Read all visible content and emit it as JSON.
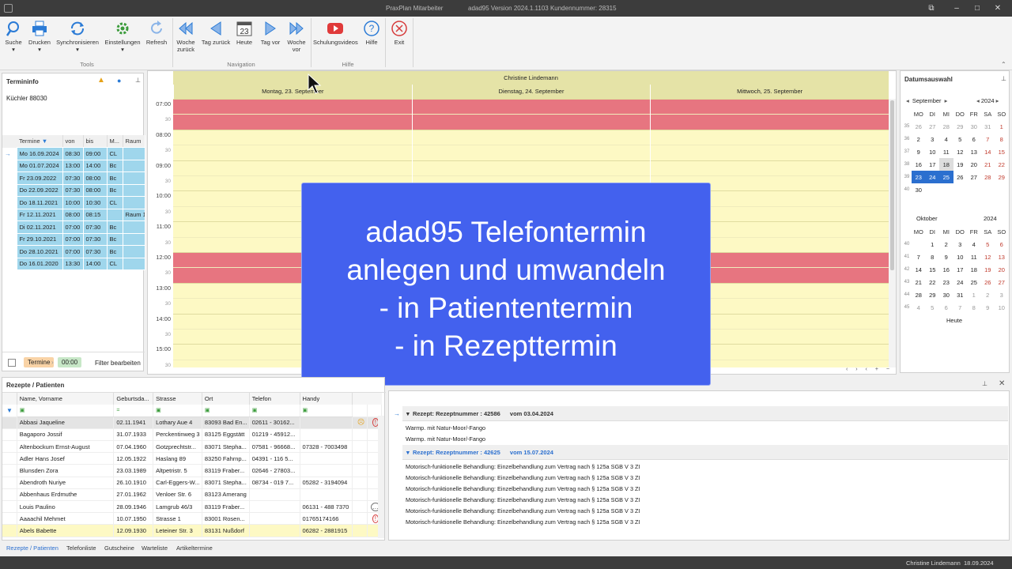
{
  "titlebar": {
    "app": "PraxPlan Mitarbeiter",
    "version": "adad95 Version 2024.1.1103  Kundennummer: 28315"
  },
  "ribbon": {
    "buttons": [
      {
        "label": "Suche",
        "sub": "▾"
      },
      {
        "label": "Drucken",
        "sub": "▾"
      },
      {
        "label": "Synchronisieren",
        "sub": "▾"
      },
      {
        "label": "Einstellungen",
        "sub": "▾"
      },
      {
        "label": "Refresh",
        "sub": ""
      },
      {
        "label": "Woche",
        "sub": "zurück"
      },
      {
        "label": "Tag zurück",
        "sub": ""
      },
      {
        "label": "Heute",
        "sub": ""
      },
      {
        "label": "Tag vor",
        "sub": ""
      },
      {
        "label": "Woche",
        "sub": "vor"
      },
      {
        "label": "Schulungsvideos",
        "sub": ""
      },
      {
        "label": "Hilfe",
        "sub": ""
      },
      {
        "label": "Exit",
        "sub": ""
      }
    ],
    "heute_day": "23",
    "groups": [
      "Tools",
      "Navigation",
      "Hilfe"
    ]
  },
  "termininfo": {
    "title": "Termininfo",
    "patient": "Küchler 88030",
    "columns": [
      "Termine",
      "von",
      "bis",
      "M...",
      "Raum"
    ],
    "rows": [
      [
        "Mo 16.09.2024",
        "08:30",
        "09:00",
        "CL",
        ""
      ],
      [
        "Mo 01.07.2024",
        "13:00",
        "14:00",
        "Bc",
        ""
      ],
      [
        "Fr 23.09.2022",
        "07:30",
        "08:00",
        "Bc",
        ""
      ],
      [
        "Do 22.09.2022",
        "07:30",
        "08:00",
        "Bc",
        ""
      ],
      [
        "Do 18.11.2021",
        "10:00",
        "10:30",
        "CL",
        ""
      ],
      [
        "Fr 12.11.2021",
        "08:00",
        "08:15",
        "",
        "Raum 1"
      ],
      [
        "Di 02.11.2021",
        "07:00",
        "07:30",
        "Bc",
        ""
      ],
      [
        "Fr 29.10.2021",
        "07:00",
        "07:30",
        "Bc",
        ""
      ],
      [
        "Do 28.10.2021",
        "07:00",
        "07:30",
        "Bc",
        ""
      ],
      [
        "Do 16.01.2020",
        "13:30",
        "14:00",
        "CL",
        ""
      ]
    ],
    "footer": {
      "chip1": "Termine",
      "chip2": "00:00",
      "filter": "Filter bearbeiten"
    }
  },
  "calendar": {
    "therapist": "Christine Lindemann",
    "days": [
      "Montag, 23. September",
      "Dienstag, 24. September",
      "Mittwoch, 25. September"
    ],
    "hours": [
      "07:00",
      "08:00",
      "09:00",
      "10:00",
      "11:00",
      "12:00",
      "13:00",
      "14:00",
      "15:00"
    ],
    "half": "30"
  },
  "overlay": {
    "lines": [
      "adad95 Telefontermin",
      "anlegen und umwandeln",
      "- in Patiententermin",
      "- in Rezepttermin"
    ]
  },
  "datumsauswahl": {
    "title": "Datumsauswahl",
    "month1": "September",
    "year1": "2024",
    "month2": "Oktober",
    "year2": "2024",
    "weekdays": [
      "MO",
      "DI",
      "MI",
      "DO",
      "FR",
      "SA",
      "SO"
    ],
    "sep_weeks": [
      [
        "35",
        "26",
        "27",
        "28",
        "29",
        "30",
        "31",
        "1"
      ],
      [
        "36",
        "2",
        "3",
        "4",
        "5",
        "6",
        "7",
        "8"
      ],
      [
        "37",
        "9",
        "10",
        "11",
        "12",
        "13",
        "14",
        "15"
      ],
      [
        "38",
        "16",
        "17",
        "18",
        "19",
        "20",
        "21",
        "22"
      ],
      [
        "39",
        "23",
        "24",
        "25",
        "26",
        "27",
        "28",
        "29"
      ],
      [
        "40",
        "30",
        "",
        "",
        "",
        "",
        "",
        ""
      ]
    ],
    "oct_weeks": [
      [
        "40",
        "",
        "1",
        "2",
        "3",
        "4",
        "5",
        "6"
      ],
      [
        "41",
        "7",
        "8",
        "9",
        "10",
        "11",
        "12",
        "13"
      ],
      [
        "42",
        "14",
        "15",
        "16",
        "17",
        "18",
        "19",
        "20"
      ],
      [
        "43",
        "21",
        "22",
        "23",
        "24",
        "25",
        "26",
        "27"
      ],
      [
        "44",
        "28",
        "29",
        "30",
        "31",
        "1",
        "2",
        "3"
      ],
      [
        "45",
        "4",
        "5",
        "6",
        "7",
        "8",
        "9",
        "10"
      ]
    ],
    "heute": "Heute"
  },
  "patients": {
    "title": "Rezepte / Patienten",
    "columns": [
      "Name, Vorname",
      "Geburtsda...",
      "Strasse",
      "Ort",
      "Telefon",
      "Handy"
    ],
    "rows": [
      [
        "Abbasi Jaqueline",
        "02.11.1941",
        "Lothary Aue 4",
        "83093 Bad En...",
        "02611 - 30162...",
        ""
      ],
      [
        "Bagaporo Jossif",
        "31.07.1933",
        "Perckentinweg 3",
        "83125 Eggstätt",
        "01219 - 45912...",
        ""
      ],
      [
        "Altenbockum Ernst-August",
        "07.04.1960",
        "Gotzprechtstr...",
        "83071 Stepha...",
        "07581 - 96668...",
        "07328 - 7003498"
      ],
      [
        "Adler Hans Josef",
        "12.05.1922",
        "Haslang 89",
        "83250 Fahrnp...",
        "04391 - 116 5...",
        ""
      ],
      [
        "Blunsden Zora",
        "23.03.1989",
        "Altpetristr. 5",
        "83119 Fraber...",
        "02646 - 27803...",
        ""
      ],
      [
        "Abendroth Nuriye",
        "26.10.1910",
        "Carl-Eggers-W...",
        "83071 Stepha...",
        "08734 - 019 7...",
        "05282 - 3194094"
      ],
      [
        "Abbenhaus Erdmuthe",
        "27.01.1962",
        "Venloer Str. 6",
        "83123 Amerang",
        "",
        ""
      ],
      [
        "Louis Paulino",
        "28.09.1946",
        "Lamgrub 46/3",
        "83119 Fraber...",
        "",
        "06131 - 488 7370"
      ],
      [
        "Aaaachil Mehmet",
        "10.07.1950",
        "Strasse 1",
        "83001 Rosen...",
        "",
        "01765174166"
      ],
      [
        "Abels Babette",
        "12.09.1930",
        "Leteiner Str. 3",
        "83131 Nußdorf",
        "",
        "06282 - 2881915"
      ]
    ]
  },
  "rezepte": {
    "r1": {
      "label": "Rezept: Rezeptnummer : 42586",
      "date": "vom 03.04.2024",
      "items": [
        "Warmp. mit Natur-Moor/-Fango",
        "Warmp. mit Natur-Moor/-Fango"
      ]
    },
    "r2": {
      "label": "Rezept: Rezeptnummer : 42625",
      "date": "vom 15.07.2024",
      "items": [
        "Motorisch-funktionelle Behandlung: Einzelbehandlung zum Vertrag nach § 125a SGB V 3 ZI",
        "Motorisch-funktionelle Behandlung: Einzelbehandlung zum Vertrag nach § 125a SGB V 3 ZI",
        "Motorisch-funktionelle Behandlung: Einzelbehandlung zum Vertrag nach § 125a SGB V 3 ZI",
        "Motorisch-funktionelle Behandlung: Einzelbehandlung zum Vertrag nach § 125a SGB V 3 ZI",
        "Motorisch-funktionelle Behandlung: Einzelbehandlung zum Vertrag nach § 125a SGB V 3 ZI",
        "Motorisch-funktionelle Behandlung: Einzelbehandlung zum Vertrag nach § 125a SGB V 3 ZI"
      ]
    }
  },
  "bottomtabs": [
    "Rezepte / Patienten",
    "Telefonliste",
    "Gutscheine",
    "Warteliste",
    "Artikeltermine"
  ],
  "status": {
    "user": "Christine Lindemann",
    "date": "18.09.2024"
  },
  "colors": {
    "accent": "#2b6fcf",
    "overlay": "#4361ee",
    "slot_red": "#e77580",
    "slot_yellow": "#fdf9c4",
    "header_olive": "#e5e3a7"
  }
}
